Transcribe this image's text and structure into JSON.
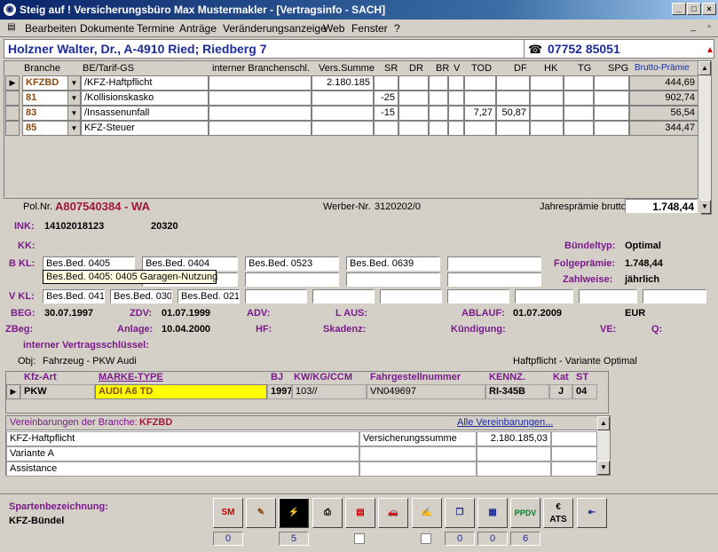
{
  "window": {
    "title": "Steig auf ! Versicherungsbüro Max Mustermakler - [Vertragsinfo - SACH]"
  },
  "menu": [
    "Bearbeiten",
    "Dokumente",
    "Termine",
    "Anträge",
    "Veränderungsanzeige",
    "Web",
    "Fenster",
    "?"
  ],
  "header": {
    "name": "Holzner Walter, Dr., A-4910 Ried; Riedberg 7",
    "phone": "07752 85051"
  },
  "grid": {
    "columns": [
      "Branche",
      "BE/Tarif-GS",
      "interner Branchenschl.",
      "Vers.Summe",
      "SR",
      "DR",
      "BR",
      "V",
      "TOD",
      "DF",
      "HK",
      "TG",
      "SPG",
      "Brutto-Prämie"
    ],
    "rows": [
      {
        "branche": "KFZBD",
        "tarif": "/KFZ-Haftpflicht",
        "summe": "2.180.185",
        "sr": "",
        "tod": "",
        "df": "",
        "praemie": "444,69"
      },
      {
        "branche": "81",
        "tarif": "/Kollisionskasko",
        "summe": "",
        "sr": "-25",
        "tod": "",
        "df": "",
        "praemie": "902,74"
      },
      {
        "branche": "83",
        "tarif": "/Insassenunfall",
        "summe": "",
        "sr": "-15",
        "tod": "7,27",
        "df": "50,87",
        "praemie": "56,54"
      },
      {
        "branche": "85",
        "tarif": "KFZ-Steuer",
        "summe": "",
        "sr": "",
        "tod": "",
        "df": "",
        "praemie": "344,47"
      }
    ]
  },
  "policy": {
    "pol_label": "Pol.Nr.",
    "pol_nr": "A807540384 - WA",
    "werber_label": "Werber-Nr.",
    "werber_nr": "3120202/0",
    "jahres_label": "Jahresprämie brutto",
    "jahres": "1.748,44"
  },
  "details": {
    "ink_label": "INK:",
    "ink1": "14102018123",
    "ink2": "20320",
    "kk_label": "KK:",
    "bkl_label": "B KL:",
    "bkl": [
      "Bes.Bed. 0405",
      "Bes.Bed. 0404",
      "Bes.Bed. 0523",
      "Bes.Bed. 0639"
    ],
    "tooltip": "Bes.Bed. 0405: 0405 Garagen-Nutzung",
    "vkl_label": "V KL:",
    "vkl": [
      "Bes.Bed. 041",
      "Bes.Bed. 030",
      "Bes.Bed. 021"
    ],
    "buendeltyp_label": "Bündeltyp:",
    "buendeltyp": "Optimal",
    "folge_label": "Folgeprämie:",
    "folge": "1.748,44",
    "zahl_label": "Zahlweise:",
    "zahl": "jährlich",
    "beg_label": "BEG:",
    "beg": "30.07.1997",
    "zdv_label": "ZDV:",
    "zdv": "01.07.1999",
    "adv_label": "ADV:",
    "laus_label": "L AUS:",
    "ablauf_label": "ABLAUF:",
    "ablauf": "01.07.2009",
    "currency": "EUR",
    "zbeg_label": "ZBeg:",
    "anlage_label": "Anlage:",
    "anlage": "10.04.2000",
    "hf_label": "HF:",
    "skadenz_label": "Skadenz:",
    "kuendigung_label": "Kündigung:",
    "ve_label": "VE:",
    "q_label": "Q:",
    "ivs_label": "interner Vertragsschlüssel:",
    "obj_label": "Obj:",
    "obj": "Fahrzeug - PKW Audi",
    "variante": "Haftpflicht - Variante Optimal"
  },
  "vehicle": {
    "columns": [
      "Kfz-Art",
      "MARKE-TYPE",
      "BJ",
      "KW/KG/CCM",
      "Fahrgestellnummer",
      "KENNZ.",
      "Kat",
      "ST"
    ],
    "row": {
      "art": "PKW",
      "marke": "AUDI A6 TD",
      "bj": "1997",
      "kw": "103//",
      "fgnr": "VN049697",
      "kennz": "RI-345B",
      "kat": "J",
      "st": "04"
    }
  },
  "agreements": {
    "title": "Vereinbarungen der Branche:",
    "branche": "KFZBD",
    "link": "Alle Vereinbarungen...",
    "rows": [
      {
        "a": "KFZ-Haftpflicht",
        "b": "Versicherungssumme",
        "c": "2.180.185,03"
      },
      {
        "a": "Variante A",
        "b": "",
        "c": ""
      },
      {
        "a": "Assistance",
        "b": "",
        "c": ""
      }
    ]
  },
  "footer": {
    "sparte_label": "Spartenbezeichnung:",
    "sparte": "KFZ-Bündel",
    "counts": {
      "sm": "0",
      "w": "5",
      "c1": "0",
      "c2": "0",
      "ppdv": "6"
    },
    "ats": "ATS"
  }
}
